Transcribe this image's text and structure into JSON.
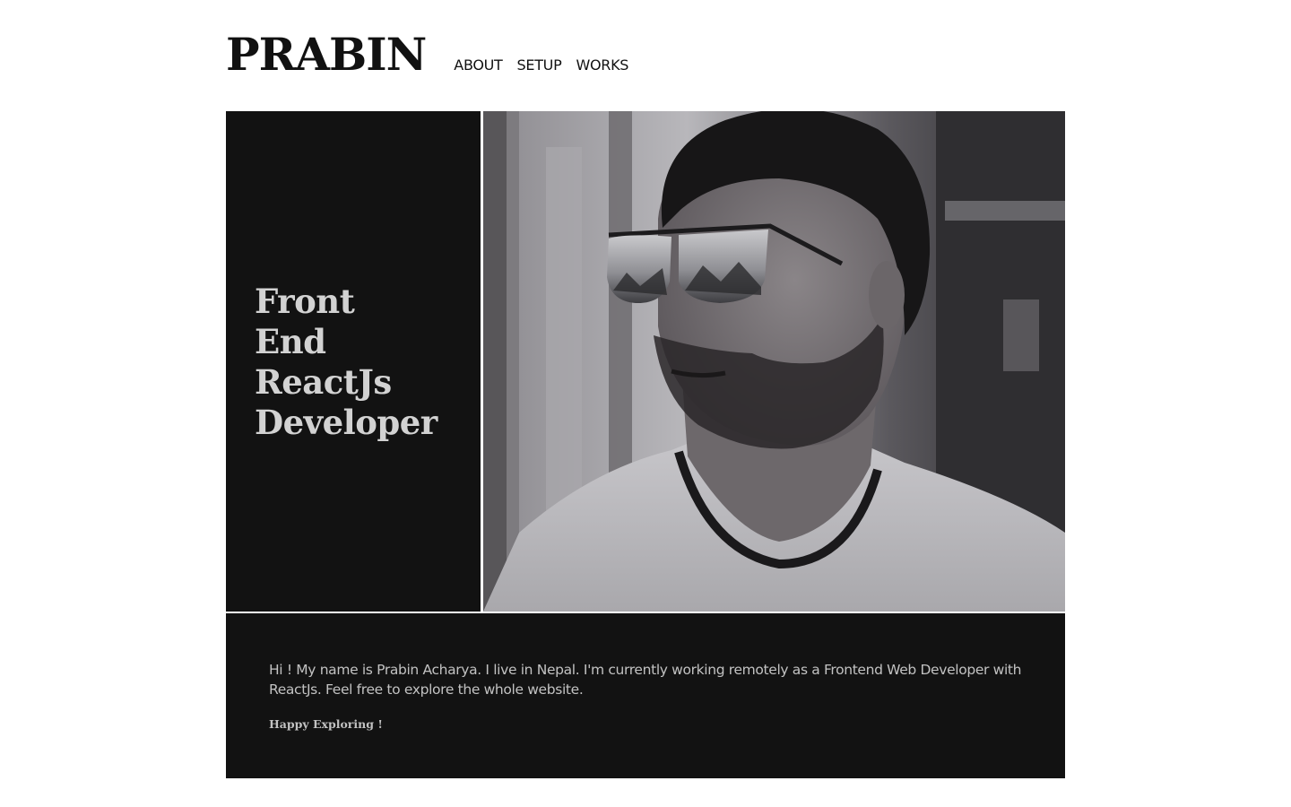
{
  "header": {
    "logo": "PRABIN",
    "nav": [
      {
        "label": "ABOUT"
      },
      {
        "label": "SETUP"
      },
      {
        "label": "WORKS"
      }
    ]
  },
  "hero": {
    "heading_lines": [
      "Front",
      "End",
      "ReactJs",
      "Developer"
    ],
    "photo": {
      "subject": "portrait of man wearing mirrored sunglasses",
      "style": "grayscale"
    }
  },
  "about": {
    "text": "Hi ! My name is Prabin Acharya. I live in Nepal. I'm currently working remotely as a Frontend Web Developer with ReactJs. Feel free to explore the whole website.",
    "signoff": "Happy Exploring !"
  },
  "colors": {
    "panel_background": "#121212",
    "heading_text": "#d2d2d2",
    "body_text": "#c2c2c2",
    "page_background": "#ffffff"
  }
}
